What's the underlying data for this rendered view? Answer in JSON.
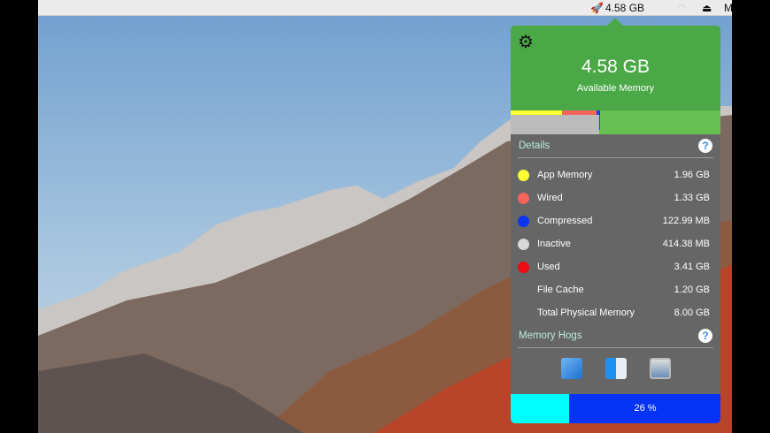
{
  "menubar": {
    "memory_label": "4.58 GB",
    "app_menu_letter": "M"
  },
  "popup": {
    "available_value": "4.58 GB",
    "available_label": "Available Memory",
    "bar_segments": [
      {
        "name": "app",
        "percent": 24.5,
        "color": "#ffff33"
      },
      {
        "name": "wired",
        "percent": 16.6,
        "color": "#f4645c"
      },
      {
        "name": "compressed",
        "percent": 1.5,
        "color": "#1a3ff0"
      }
    ],
    "details_label": "Details",
    "help": "?",
    "rows": [
      {
        "label": "App Memory",
        "value": "1.96 GB",
        "color": "#ffff33"
      },
      {
        "label": "Wired",
        "value": "1.33 GB",
        "color": "#f4645c"
      },
      {
        "label": "Compressed",
        "value": "122.99 MB",
        "color": "#0a34f0"
      },
      {
        "label": "Inactive",
        "value": "414.38 MB",
        "color": "#d8d8d8"
      },
      {
        "label": "Used",
        "value": "3.41 GB",
        "color": "#ee0b12"
      },
      {
        "label": "File Cache",
        "value": "1.20 GB",
        "color": ""
      },
      {
        "label": "Total Physical Memory",
        "value": "8.00 GB",
        "color": ""
      }
    ],
    "hogs_label": "Memory Hogs",
    "hogs": [
      "xcode-icon",
      "finder-icon",
      "preview-icon"
    ],
    "cpu_percent": 26,
    "cpu_label": "26 %"
  }
}
